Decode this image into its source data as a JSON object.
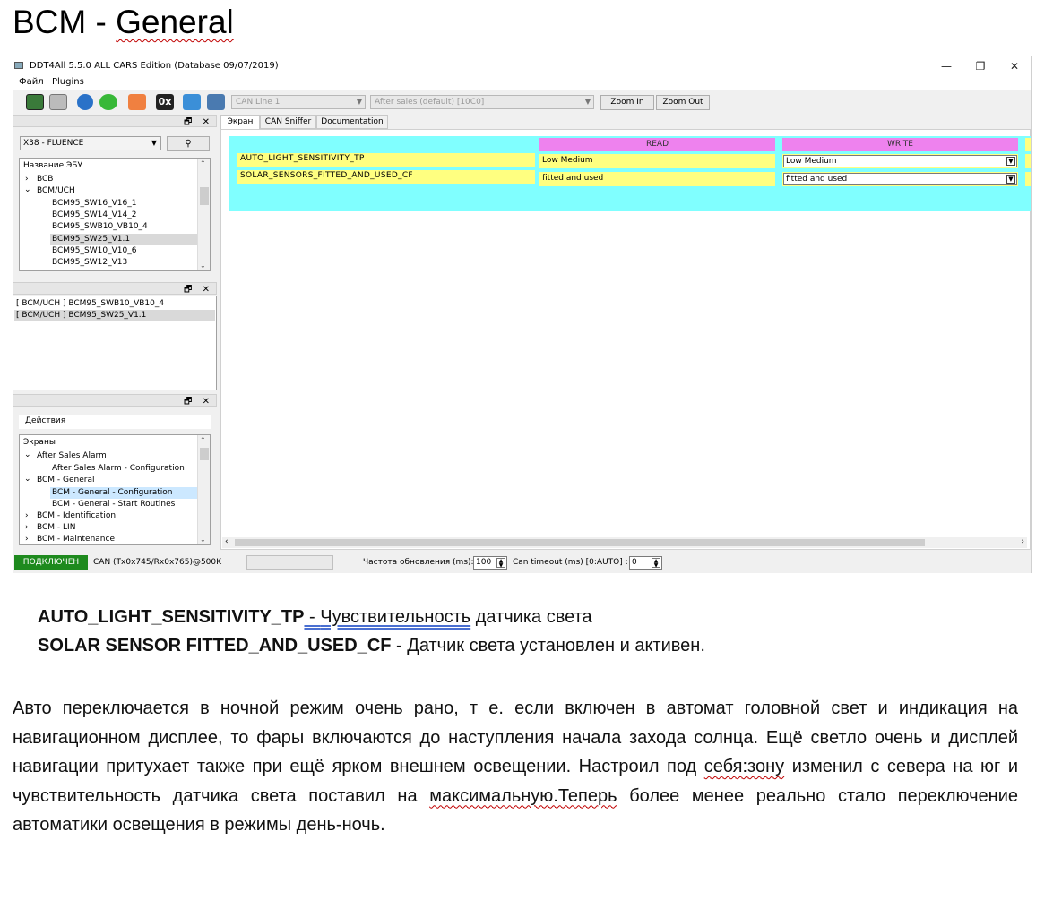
{
  "document": {
    "title_prefix": "BCM - ",
    "title_word": "General",
    "definitions": [
      {
        "term": "AUTO_LIGHT_SENSITIVITY_TP",
        "sep": " - ",
        "desc_link": "Чувствительность",
        "desc_rest": " датчика света"
      },
      {
        "term": "SOLAR SENSOR FITTED_AND_USED_CF",
        "sep": " - ",
        "desc": "Датчик света установлен и активен."
      }
    ],
    "paragraph": {
      "p1": "Авто переключается в ночной режим очень рано, т е. если включен в автомат головной свет и индикация на навигационном дисплее, то фары включаются до наступления начала захода солнца. Ещё светло очень и дисплей навигации притухает также при ещё ярком внешнем освещении. Настроил под ",
      "w1": "себя:зону",
      "p2": " изменил с севера на юг и чувствительность датчика света поставил на ",
      "w2": "максимальную.Теперь",
      "p3": " более менее реально стало переключение автоматики освещения в режимы день-ночь."
    }
  },
  "app": {
    "title": "DDT4All 5.5.0 ALL CARS Edition (Database 09/07/2019)",
    "window_controls": {
      "minimize": "—",
      "restore": "❐",
      "close": "✕"
    },
    "menu": [
      "Файл",
      "Plugins"
    ],
    "toolbar": {
      "hex_label": "0x",
      "can_line": "CAN Line 1",
      "session": "After sales (default) [10C0]",
      "zoom_in": "Zoom In",
      "zoom_out": "Zoom Out"
    },
    "dock_controls": "🗗 ✕",
    "vehicle": "X38 - FLUENCE",
    "search_icon_glyph": "⚲",
    "ecu_tree": {
      "header": "Название ЭБУ",
      "items": [
        {
          "label": "BCB",
          "caret": "›"
        },
        {
          "label": "BCM/UCH",
          "caret": "⌄"
        },
        {
          "label": "BCM95_SW16_V16_1"
        },
        {
          "label": "BCM95_SW14_V14_2"
        },
        {
          "label": "BCM95_SWB10_VB10_4"
        },
        {
          "label": "BCM95_SW25_V1.1"
        },
        {
          "label": "BCM95_SW10_V10_6"
        },
        {
          "label": "BCM95_SW12_V13"
        }
      ]
    },
    "ecu_list": [
      "[ BCM/UCH ] BCM95_SWB10_VB10_4",
      "[ BCM/UCH ] BCM95_SW25_V1.1"
    ],
    "actions_label": "Действия",
    "screens_tree": {
      "header": "Экраны",
      "items": [
        {
          "label": "After Sales Alarm",
          "caret": "⌄"
        },
        {
          "label": "After Sales Alarm - Configuration"
        },
        {
          "label": "BCM - General",
          "caret": "⌄"
        },
        {
          "label": "BCM - General - Configuration"
        },
        {
          "label": "BCM - General - Start Routines"
        },
        {
          "label": "BCM - Identification",
          "caret": "›"
        },
        {
          "label": "BCM - LIN",
          "caret": "›"
        },
        {
          "label": "BCM - Maintenance",
          "caret": "›"
        }
      ]
    },
    "tabs": [
      "Экран",
      "CAN Sniffer",
      "Documentation"
    ],
    "grid": {
      "read_header": "READ",
      "write_header": "WRITE",
      "rows": [
        {
          "label": "AUTO_LIGHT_SENSITIVITY_TP",
          "read": "Low Medium",
          "write": "Low Medium"
        },
        {
          "label": "SOLAR_SENSORS_FITTED_AND_USED_CF",
          "read": "fitted and used",
          "write": "fitted and used"
        }
      ]
    },
    "status": {
      "connected": "ПОДКЛЮЧЕН",
      "can": "CAN (Tx0x745/Rx0x765)@500K",
      "refresh_label": "Частота обновления (ms):",
      "refresh_value": "100",
      "timeout_label": "Can timeout (ms) [0:AUTO] :",
      "timeout_value": "0"
    }
  }
}
